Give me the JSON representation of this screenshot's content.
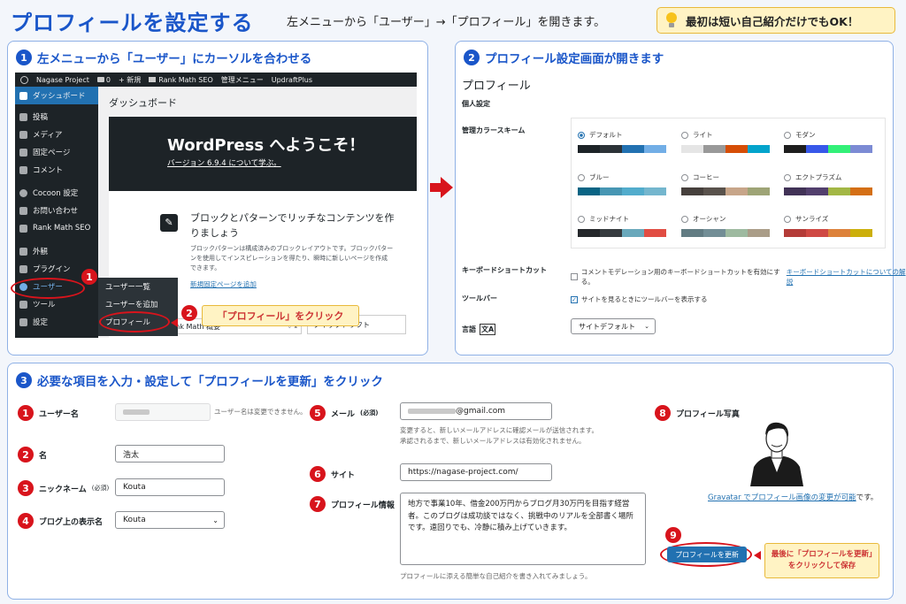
{
  "header": {
    "title": "プロフィールを設定する",
    "subtitle": "左メニューから「ユーザー」→「プロフィール」を開きます。",
    "tip": "最初は短い自己紹介だけでもOK！"
  },
  "step1": {
    "num": "1",
    "title": "左メニューから「ユーザー」にカーソルを合わせる",
    "topbar": [
      "Nagase Project",
      "0",
      "+ 新規",
      "Rank Math SEO",
      "管理メニュー",
      "UpdraftPlus"
    ],
    "menu": [
      "ダッシュボード",
      "投稿",
      "メディア",
      "固定ページ",
      "コメント",
      "Cocoon 設定",
      "お問い合わせ",
      "Rank Math SEO",
      "外観",
      "プラグイン",
      "ユーザー",
      "ツール",
      "設定"
    ],
    "submenu": [
      "ユーザー一覧",
      "ユーザーを追加",
      "プロフィール"
    ],
    "page_title": "ダッシュボード",
    "welcome_title": "WordPress へようこそ！",
    "welcome_link": "バージョン 6.9.4 について学ぶ。",
    "block_title": "ブロックとパターンでリッチなコンテンツを作りましょう",
    "block_desc": "ブロックパターンは構成済みのブロックレイアウトです。ブロックパターンを使用してインスピレーションを得たり、瞬時に新しいページを作成できます。",
    "block_link": "新規固定ページを追加",
    "rank_math": "Rank Math 概要",
    "quick_draft": "クイックドラフト",
    "marker1": "1",
    "marker2": "2",
    "callout": "「プロフィール」をクリック"
  },
  "step2": {
    "num": "2",
    "title": "プロフィール設定画面が開きます",
    "heading": "プロフィール",
    "personal": "個人設定",
    "color_label": "管理カラースキーム",
    "schemes": [
      {
        "name": "デフォルト",
        "selected": true,
        "colors": [
          "#1d2327",
          "#2c3338",
          "#2271b1",
          "#72aee6"
        ]
      },
      {
        "name": "ライト",
        "selected": false,
        "colors": [
          "#e5e5e5",
          "#999999",
          "#d64e07",
          "#04a4cc"
        ]
      },
      {
        "name": "モダン",
        "selected": false,
        "colors": [
          "#1e1e1e",
          "#3858e9",
          "#33f078",
          "#7c8bd4"
        ]
      },
      {
        "name": "ブルー",
        "selected": false,
        "colors": [
          "#096484",
          "#4796b3",
          "#52accc",
          "#74b6ce"
        ]
      },
      {
        "name": "コーヒー",
        "selected": false,
        "colors": [
          "#46403c",
          "#59524c",
          "#c7a589",
          "#9ea476"
        ]
      },
      {
        "name": "エクトプラズム",
        "selected": false,
        "colors": [
          "#413256",
          "#523f6d",
          "#a3b745",
          "#d46f15"
        ]
      },
      {
        "name": "ミッドナイト",
        "selected": false,
        "colors": [
          "#25282b",
          "#363b3f",
          "#69a8bb",
          "#e14d43"
        ]
      },
      {
        "name": "オーシャン",
        "selected": false,
        "colors": [
          "#627c83",
          "#738e96",
          "#9ebaa0",
          "#aa9d88"
        ]
      },
      {
        "name": "サンライズ",
        "selected": false,
        "colors": [
          "#b43c38",
          "#cf4944",
          "#dd823b",
          "#ccaf0b"
        ]
      }
    ],
    "keyboard_label": "キーボードショートカット",
    "keyboard_text": "コメントモデレーション用のキーボードショートカットを有効にする。",
    "keyboard_link": "キーボードショートカットについての解説",
    "toolbar_label": "ツールバー",
    "toolbar_text": "サイトを見るときにツールバーを表示する",
    "language_label": "言語",
    "language_value": "サイトデフォルト"
  },
  "step3": {
    "num": "3",
    "title": "必要な項目を入力・設定して「プロフィールを更新」をクリック",
    "username_label": "ユーザー名",
    "username_note": "ユーザー名は変更できません。",
    "firstname_label": "名",
    "firstname_value": "浩太",
    "nickname_label": "ニックネーム",
    "nickname_req": "(必須)",
    "nickname_value": "Kouta",
    "display_label": "ブログ上の表示名",
    "display_value": "Kouta",
    "email_label": "メール",
    "email_req": "(必須)",
    "email_value": "@gmail.com",
    "email_note1": "変更すると、新しいメールアドレスに確認メールが送信されます。",
    "email_note2": "承認されるまで、新しいメールアドレスは有効化されません。",
    "site_label": "サイト",
    "site_value": "https://nagase-project.com/",
    "bio_label": "プロフィール情報",
    "bio_value": "地方で事業10年、借金200万円からブログ月30万円を目指す経営者。このブログは成功談ではなく、挑戦中のリアルを全部書く場所です。遠回りでも、冷静に積み上げていきます。",
    "bio_note": "プロフィールに添える簡単な自己紹介を書き入れてみましょう。",
    "photo_label": "プロフィール写真",
    "gravatar_link": "Gravatar でプロフィール画像の変更が可能",
    "gravatar_suffix": "です。",
    "update_button": "プロフィールを更新",
    "final_callout": "最後に「プロフィールを更新」をクリックして保存",
    "markers": [
      "1",
      "2",
      "3",
      "4",
      "5",
      "6",
      "7",
      "8",
      "9"
    ]
  }
}
